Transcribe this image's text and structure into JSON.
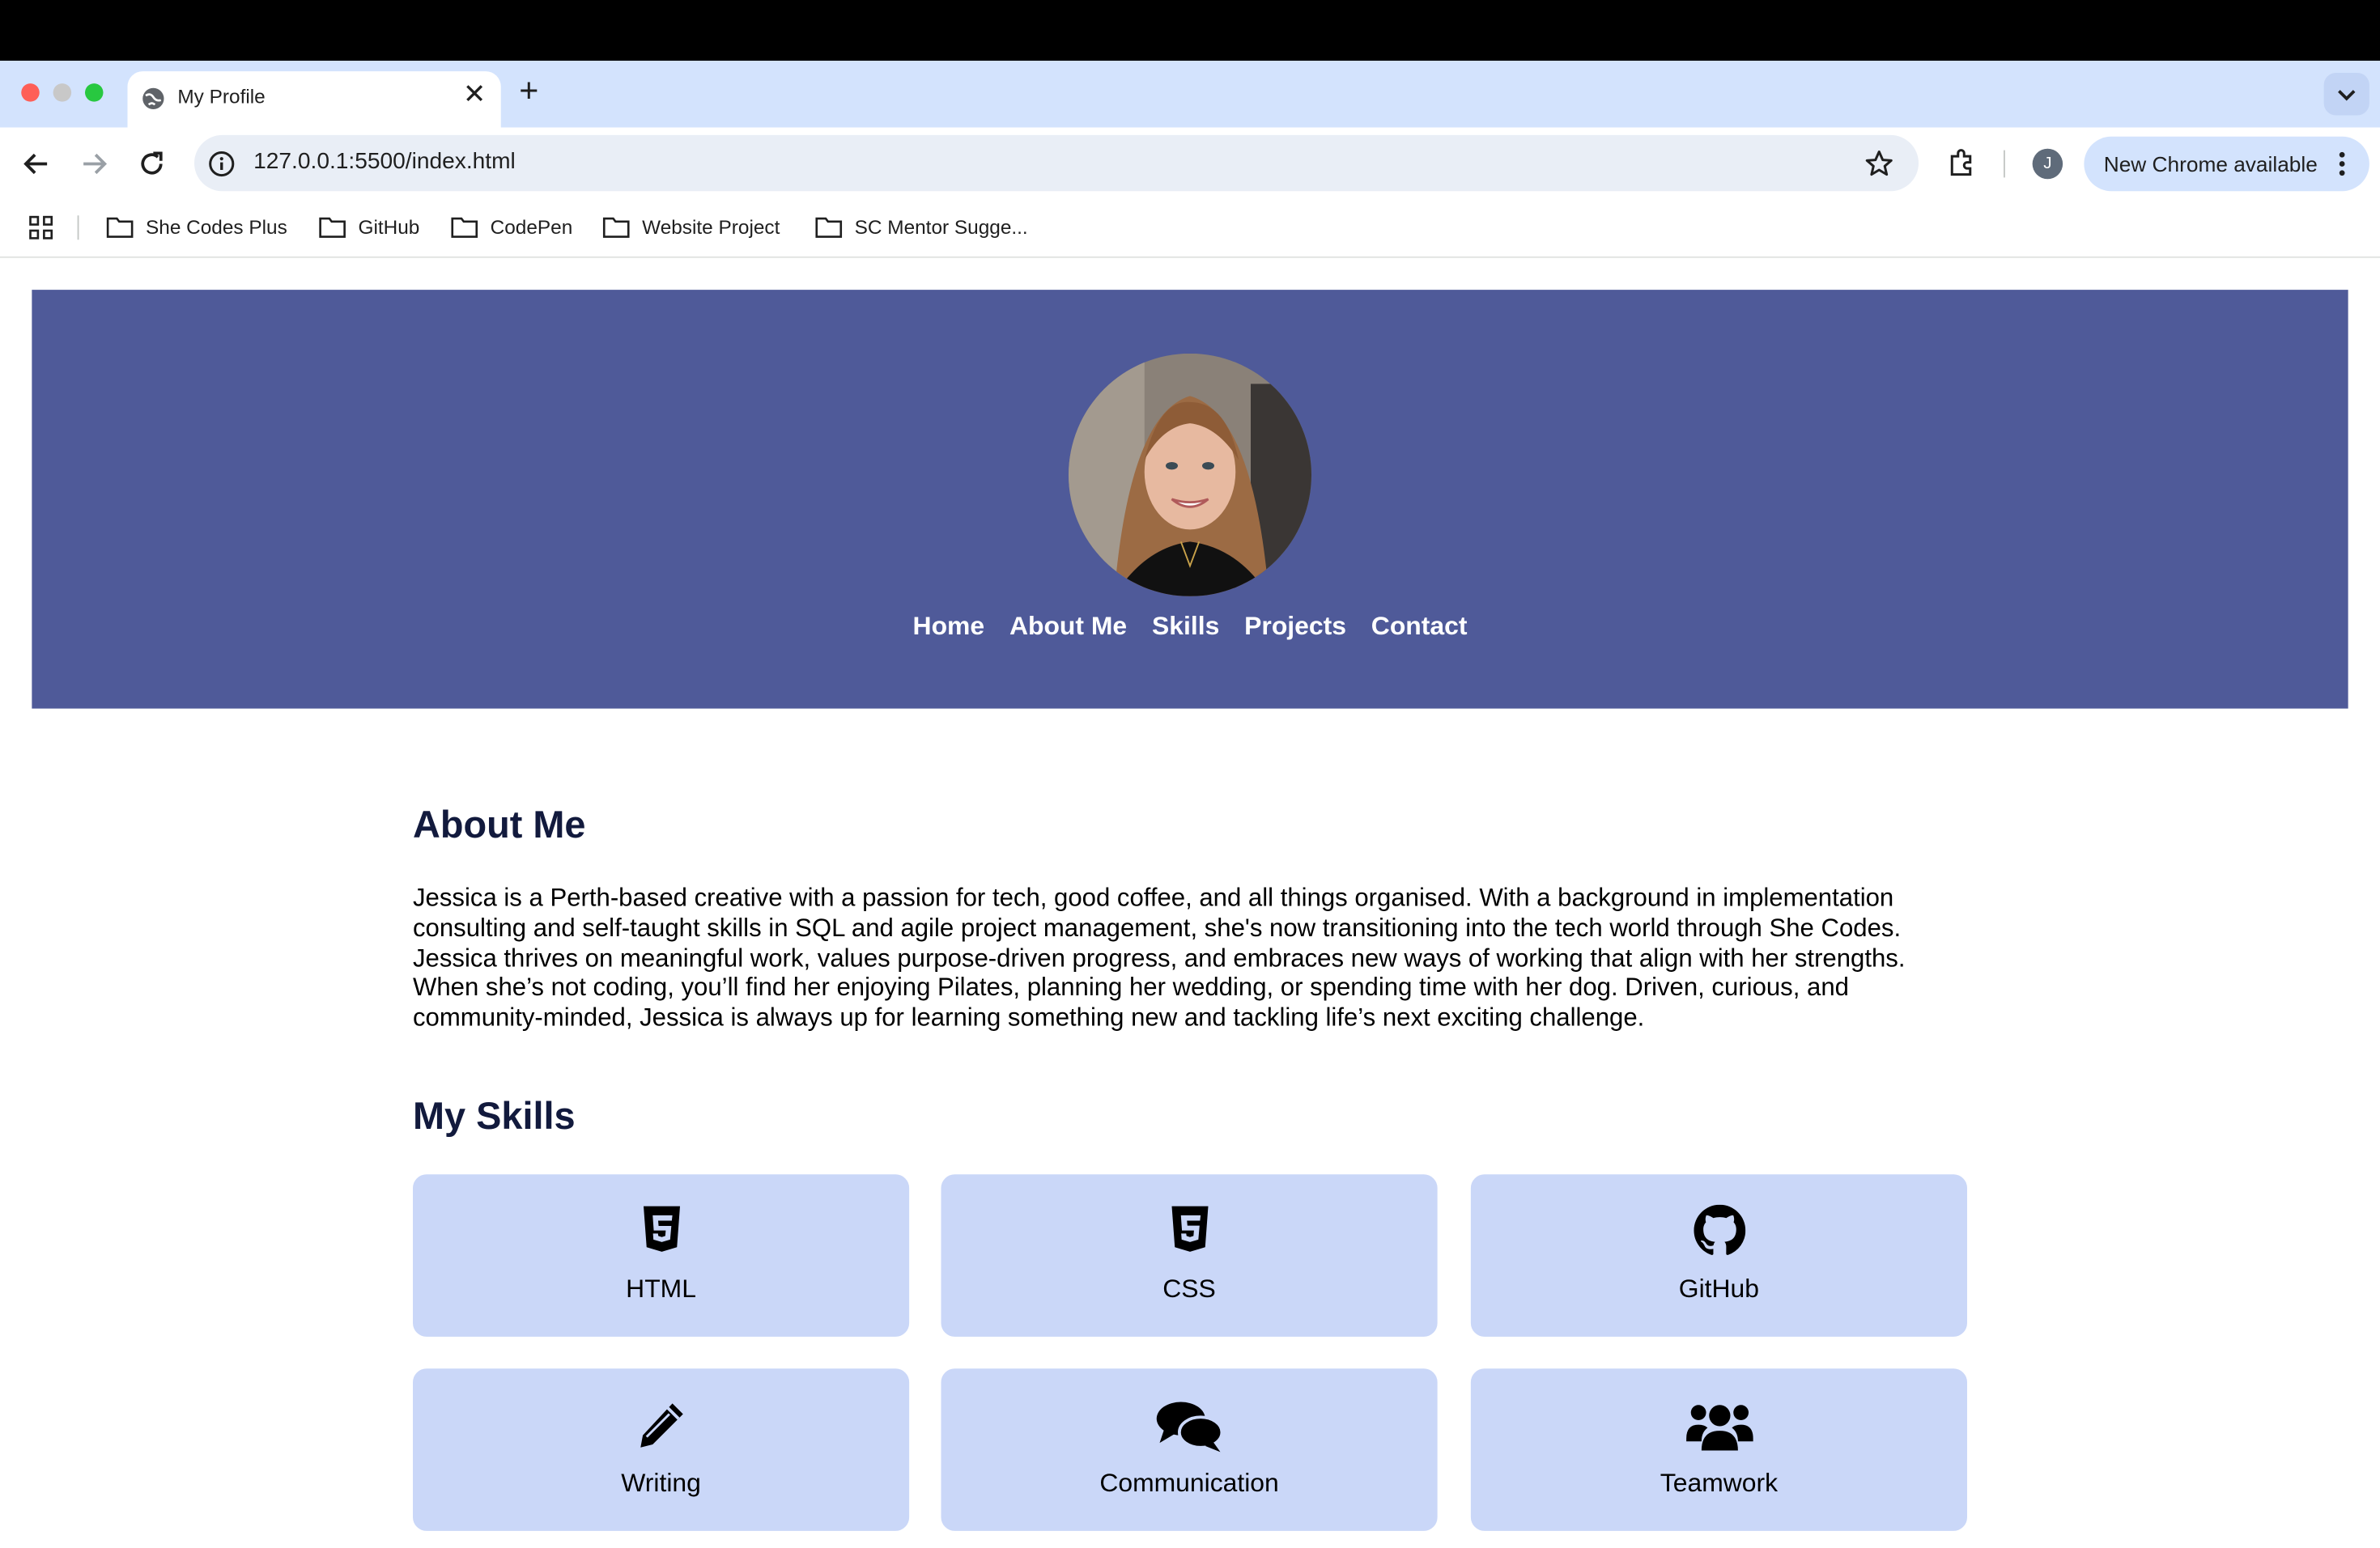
{
  "browser": {
    "tab_title": "My Profile",
    "url": "127.0.0.1:5500/index.html",
    "avatar_initial": "J",
    "update_label": "New Chrome available",
    "bookmarks": [
      {
        "label": "She Codes Plus"
      },
      {
        "label": "GitHub"
      },
      {
        "label": "CodePen"
      },
      {
        "label": "Website Project"
      },
      {
        "label": "SC Mentor Sugge..."
      }
    ]
  },
  "page": {
    "nav": [
      "Home",
      "About Me",
      "Skills",
      "Projects",
      "Contact"
    ],
    "about": {
      "title": "About Me",
      "text": "Jessica is a Perth-based creative with a passion for tech, good coffee, and all things organised. With a background in implementation consulting and self-taught skills in SQL and agile project management, she's now transitioning into the tech world through She Codes. Jessica thrives on meaningful work, values purpose-driven progress, and embraces new ways of working that align with her strengths. When she’s not coding, you’ll find her enjoying Pilates, planning her wedding, or spending time with her dog. Driven, curious, and community-minded, Jessica is always up for learning something new and tackling life’s next exciting challenge."
    },
    "skills": {
      "title": "My Skills",
      "items": [
        {
          "label": "HTML",
          "icon": "html5-icon"
        },
        {
          "label": "CSS",
          "icon": "css3-icon"
        },
        {
          "label": "GitHub",
          "icon": "github-icon"
        },
        {
          "label": "Writing",
          "icon": "pencil-icon"
        },
        {
          "label": "Communication",
          "icon": "comments-icon"
        },
        {
          "label": "Teamwork",
          "icon": "users-icon"
        }
      ]
    }
  },
  "colors": {
    "hero_bg": "#4f5a99",
    "skill_card_bg": "#cad7f8",
    "heading": "#121a3d"
  }
}
